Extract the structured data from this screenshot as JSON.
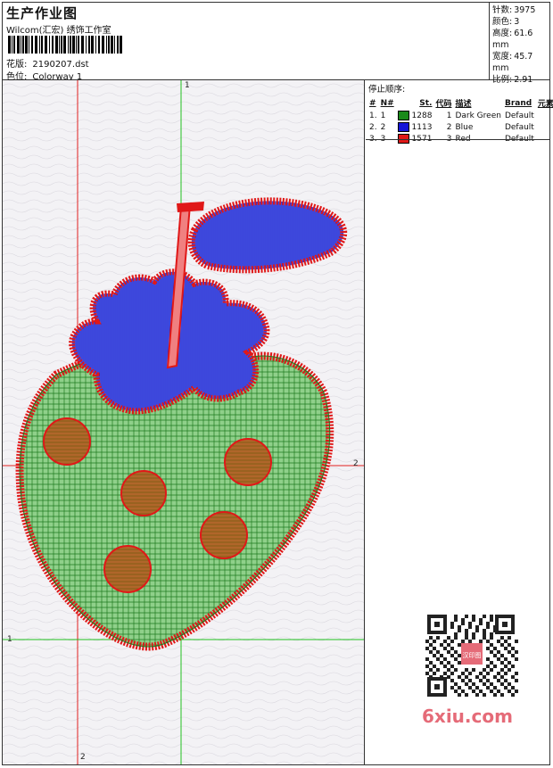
{
  "header": {
    "title": "生产作业图",
    "subtitle": "Wilcom(汇宏) 绣饰工作室",
    "design_label": "花版:",
    "design_value": "2190207.dst",
    "colorway_label": "色位:",
    "colorway_value": "Colorway 1"
  },
  "stats": [
    {
      "label": "针数:",
      "value": "3975"
    },
    {
      "label": "颜色:",
      "value": "3"
    },
    {
      "label": "高度:",
      "value": "61.6 mm"
    },
    {
      "label": "宽度:",
      "value": "45.7 mm"
    },
    {
      "label": "比例:",
      "value": "2.91"
    }
  ],
  "stop_sequence": {
    "title": "停止顺序:",
    "columns": [
      "#",
      "N#",
      "St.",
      "代码",
      "描述",
      "Brand",
      "元素"
    ],
    "rows": [
      {
        "idx": "1.",
        "n": "1",
        "color": "#1a8a1a",
        "st": "1288",
        "code": "1",
        "desc": "Dark Green",
        "brand": "Default"
      },
      {
        "idx": "2.",
        "n": "2",
        "color": "#1515d8",
        "st": "1113",
        "code": "2",
        "desc": "Blue",
        "brand": "Default"
      },
      {
        "idx": "3.",
        "n": "3",
        "color": "#e01818",
        "st": "1571",
        "code": "3",
        "desc": "Red",
        "brand": "Default"
      }
    ]
  },
  "markers": {
    "top": "1",
    "right": "2",
    "left": "1",
    "bottom": "2"
  },
  "watermark": "6xiu.com",
  "seal_text": "汉印图"
}
